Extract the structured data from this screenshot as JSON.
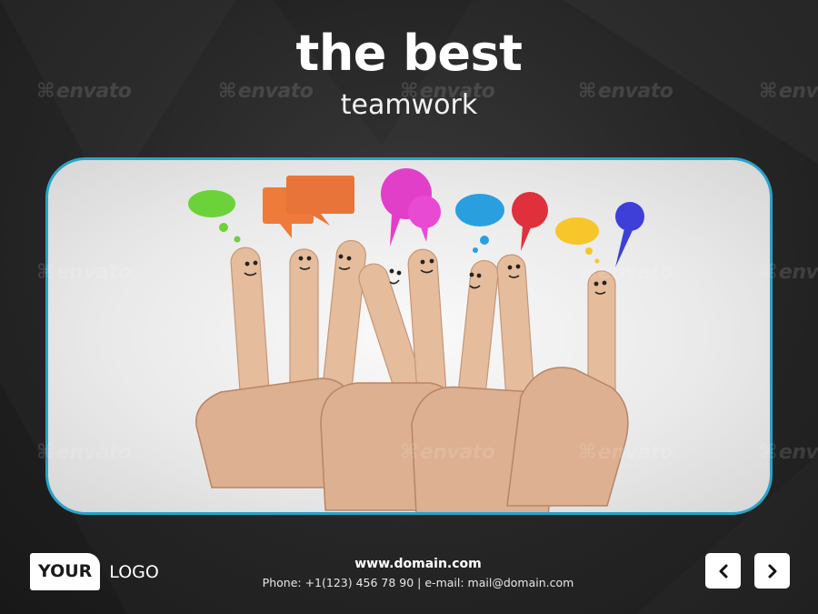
{
  "slide": {
    "title": "the best",
    "subtitle": "teamwork"
  },
  "watermark": {
    "text": "envato"
  },
  "image": {
    "description_icon": "smiley-fingers-photo-icon",
    "speech_bubble_colors": [
      "#6cd23a",
      "#ee7b3a",
      "#e23fc9",
      "#2a9fe0",
      "#e0303c",
      "#f6c62a",
      "#3d3fd8"
    ]
  },
  "footer": {
    "logo_bold": "YOUR",
    "logo_text": "LOGO",
    "url": "www.domain.com",
    "contact": "Phone: +1(123) 456 78 90 | e-mail: mail@domain.com",
    "prev_icon": "chevron-left-icon",
    "next_icon": "chevron-right-icon"
  },
  "colors": {
    "accent": "#2aa3c9",
    "background": "#262626"
  }
}
